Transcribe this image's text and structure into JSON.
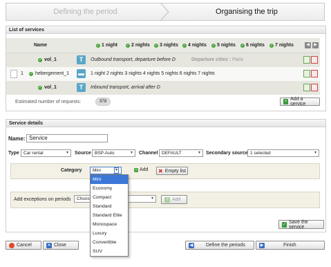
{
  "steps": [
    {
      "label": "Defining the period",
      "state": "done"
    },
    {
      "label": "Organising the trip",
      "state": "active"
    }
  ],
  "services": {
    "title": "List of services",
    "name_header": "Name",
    "nights": [
      "1 night",
      "2 nights",
      "3 nights",
      "4 nights",
      "5 nights",
      "6 nights",
      "7 nights"
    ],
    "rows": [
      {
        "name": "vol_1",
        "text": "Outbound transport, departure before D",
        "extra_label": "Departure cities :",
        "extra_value": "Paris"
      },
      {
        "num": "1",
        "name": "hebergement_1",
        "text": "1 night 2 nights 3 nights 4 nights 5 nights 6 nights 7 nights"
      },
      {
        "name": "vol_1",
        "text": "Inbound transport, arrival after D"
      }
    ],
    "estimate_label": "Estimated number of requests:",
    "estimate_value": "378",
    "add_button": "Add a service"
  },
  "details": {
    "title": "Service details",
    "name_label": "Name:",
    "name_value": "Service",
    "type_label": "Type",
    "type_value": "Car rental",
    "source_label": "Source",
    "source_value": "BSP-Auto",
    "channel_label": "Channel",
    "channel_value": "DEFAULT",
    "secondary_label": "Secondary source",
    "secondary_value": "1 selected",
    "category_label": "Category",
    "category_value": "Mini",
    "add_label": "Add",
    "empty_label": "Empty list",
    "category_options": [
      "Mini",
      "Economy",
      "Compact",
      "Standard",
      "Standard Elite",
      "Monospace",
      "Luxury",
      "Convertible",
      "SUV"
    ],
    "exceptions_label": "Add exceptions on periods",
    "exceptions_select": "Choos",
    "exceptions_add": "Add",
    "save_button": "Save the service"
  },
  "footer": {
    "cancel": "Cancel",
    "close": "Close",
    "define_periods": "Define the periods",
    "finish": "Finish"
  }
}
